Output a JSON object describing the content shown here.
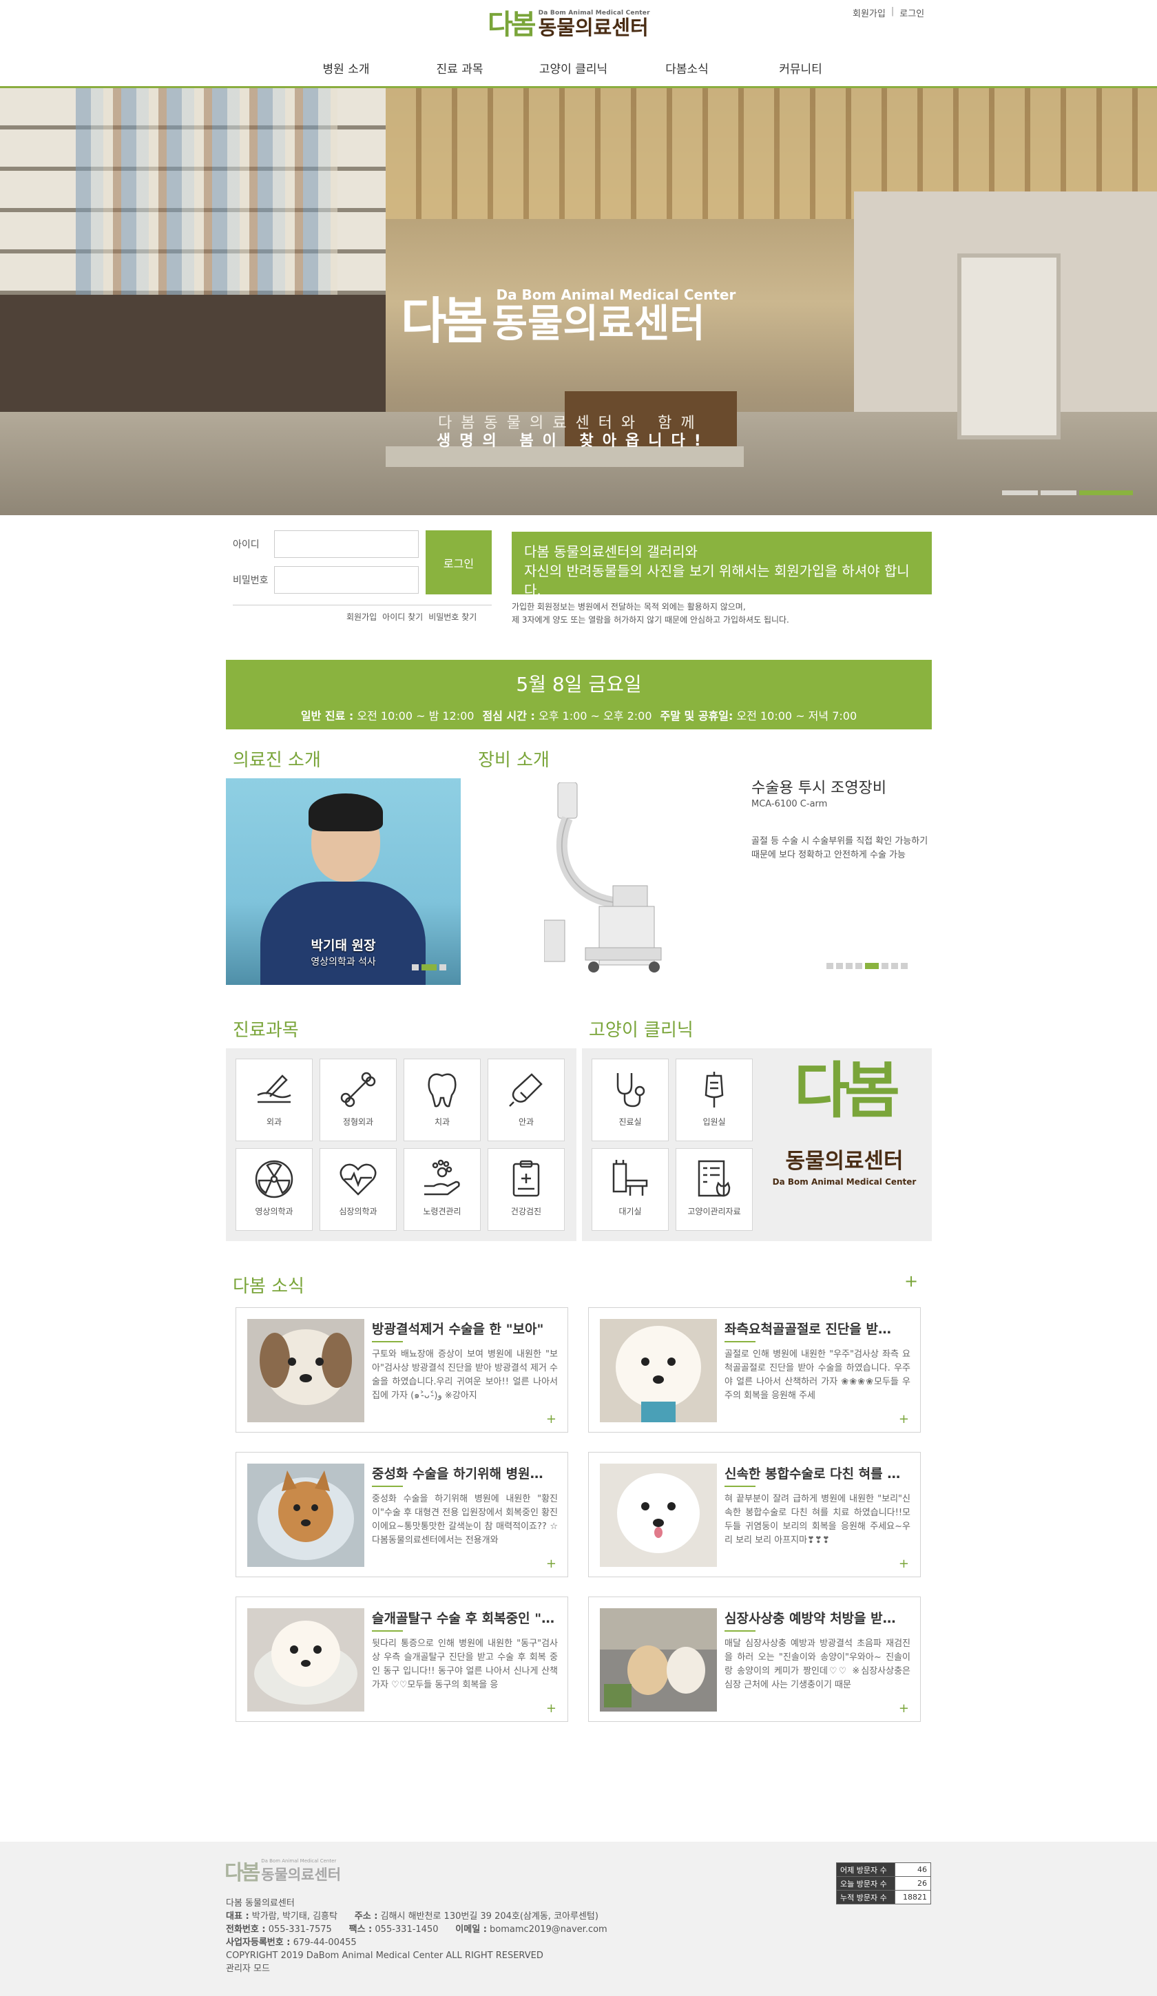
{
  "header": {
    "top_links": {
      "join": "회원가입",
      "separator": "|",
      "login": "로그인"
    },
    "logo": {
      "mark": "다봄",
      "sub": "Da Bom Animal Medical Center",
      "main": "동물의료센터"
    },
    "nav": [
      "병원 소개",
      "진료 과목",
      "고양이 클리닉",
      "다봄소식",
      "커뮤니티"
    ]
  },
  "hero": {
    "logo_mark": "다봄",
    "logo_sub": "Da Bom Animal Medical Center",
    "logo_main": "동물의료센터",
    "slogan_line1": "다봄동물의료센터와 함께",
    "slogan_line2": "생명의 봄이 찾아옵니다!",
    "slide_count": 3,
    "active_slide": 3
  },
  "login": {
    "id_label": "아이디",
    "pw_label": "비밀번호",
    "button": "로그인",
    "links": [
      "회원가입",
      "아이디 찾기",
      "비밀번호 찾기"
    ]
  },
  "notice": {
    "line1": "다봄 동물의료센터의 갤러리와",
    "line2": "자신의 반려동물들의 사진을 보기 위해서는 회원가입을 하셔야 합니다.",
    "desc1": "가입한 회원정보는 병원에서 전달하는 목적 외에는 활용하지 않으며,",
    "desc2": "제 3자에게 양도 또는 열람을 허가하지 않기 때문에 안심하고 가입하셔도 됩니다."
  },
  "hours": {
    "date": "5월 8일 금요일",
    "regular_label": "일반 진료 :",
    "regular_value": "오전 10:00 ~ 밤 12:00",
    "lunch_label": "점심 시간 :",
    "lunch_value": "오후 1:00 ~ 오후 2:00",
    "holiday_label": "주말 및 공휴일:",
    "holiday_value": "오전 10:00 ~ 저녁 7:00"
  },
  "staff": {
    "title": "의료진 소개",
    "name": "박기태 원장",
    "desc": "영상의학과 석사",
    "slide_count": 3,
    "active_slide": 2
  },
  "equipment": {
    "title": "장비 소개",
    "name": "수술용 투시 조영장비",
    "model": "MCA-6100 C-arm",
    "desc": "골절 등 수술 시 수술부위를 직접 확인 가능하기 때문에 보다 정확하고 안전하게 수술 가능",
    "slide_count": 8,
    "active_slide": 5
  },
  "departments": {
    "title": "진료과목",
    "items": [
      {
        "label": "외과",
        "icon": "surgery-icon"
      },
      {
        "label": "정형외과",
        "icon": "bone-icon"
      },
      {
        "label": "치과",
        "icon": "tooth-icon"
      },
      {
        "label": "안과",
        "icon": "eye-drop-icon"
      },
      {
        "label": "영상의학과",
        "icon": "radiation-icon"
      },
      {
        "label": "심장의학과",
        "icon": "heart-paw-icon"
      },
      {
        "label": "노령견관리",
        "icon": "paw-hand-icon"
      },
      {
        "label": "건강검진",
        "icon": "clipboard-icon"
      }
    ]
  },
  "cat_clinic": {
    "title": "고양이 클리닉",
    "items": [
      {
        "label": "진료실",
        "icon": "stethoscope-icon"
      },
      {
        "label": "입원실",
        "icon": "iv-bag-icon"
      },
      {
        "label": "대기실",
        "icon": "waiting-room-icon"
      },
      {
        "label": "고양이관리자료",
        "icon": "cat-document-icon"
      }
    ],
    "brand_mark": "다봄",
    "brand_main": "동물의료센터",
    "brand_sub": "Da Bom Animal Medical Center"
  },
  "news": {
    "title": "다봄 소식",
    "more": "+",
    "items": [
      {
        "title": "방광결석제거 수술을 한 \"보아\"",
        "text": "구토와 배뇨장애 증상이 보여 병원에 내원한 \"보아\"검사상 방광결석 진단을 받아 방광결석 제거 수술을 하였습니다.우리 귀여운 보아!! 얼른 나아서 집에 가자 (๑˃̵ᴗ˂̵)و ※강아지",
        "more": "+"
      },
      {
        "title": "좌측요척골골절로 진단을 받…",
        "text": "골절로 인해 병원에 내원한 \"우주\"검사상 좌측 요척골골절로 진단을 받아 수술을 하였습니다. 우주야 얼른 나아서 산책하러 가자 ❀❀❀❀모두들 우주의 회복을 응원해 주세",
        "more": "+"
      },
      {
        "title": "중성화 수술을 하기위해 병원…",
        "text": "중성화 수술을 하기위해 병원에 내원한 \"황진이\"수술 후 대형견 전용 입원장에서 회복중인 황진이에요~통맛통맛한 갈색눈이 참 매력적이죠?? ☆다봄동물의료센터에서는 전용개와",
        "more": "+"
      },
      {
        "title": "신속한 봉합수술로 다친 혀를 …",
        "text": "혀 끝부분이 잘려 급하게 병원에 내원한 \"보리\"신속한 봉합수술로 다친 혀를 치료 하였습니다!!모두들 귀염둥이 보리의 회복을 응원해 주세요~우리 보리 보리 아프지마❣❣❣",
        "more": "+"
      },
      {
        "title": "슬개골탈구 수술 후 회복중인 \"…",
        "text": "뒷다리 통증으로 인해 병원에 내원한 \"동구\"검사상 우측 슬개골탈구 진단을 받고 수술 후 회복 중인 동구 입니다!! 동구야 얼른 나아서 신나게 산책가자 ♡♡모두들 동구의 회복을 응",
        "more": "+"
      },
      {
        "title": "심장사상충 예방약 처방을 받…",
        "text": "매달 심장사상충 예방과 방광결석 초음파 재검진을 하러 오는 \"진솔이와 송양이\"우와아~ 진솔이랑 송양이의 케미가 짱인데♡♡ ※심장사상충은 심장 근처에 사는 기생충이기 때문",
        "more": "+"
      }
    ]
  },
  "footer": {
    "logo_sub": "Da Bom Animal Medical Center",
    "logo_mark": "다봄",
    "logo_main": "동물의료센터",
    "name": "다봄 동물의료센터",
    "rep_label": "대표 :",
    "rep_value": "박가람, 박기태, 김흥탁",
    "addr_label": "주소 :",
    "addr_value": "김해시 해반천로 130번길 39 204호(삼계동, 코아루센텀)",
    "tel_label": "전화번호 :",
    "tel_value": "055-331-7575",
    "fax_label": "팩스 :",
    "fax_value": "055-331-1450",
    "email_label": "이메일 :",
    "email_value": "bomamc2019@naver.com",
    "biz_label": "사업자등록번호 :",
    "biz_value": "679-44-00455",
    "copyright": "COPYRIGHT 2019 DaBom Animal Medical Center ALL RIGHT RESERVED",
    "admin": "관리자 모드",
    "visits": [
      {
        "label": "어제 방문자 수",
        "value": "46"
      },
      {
        "label": "오늘 방문자 수",
        "value": "26"
      },
      {
        "label": "누적 방문자 수",
        "value": "18821"
      }
    ]
  }
}
